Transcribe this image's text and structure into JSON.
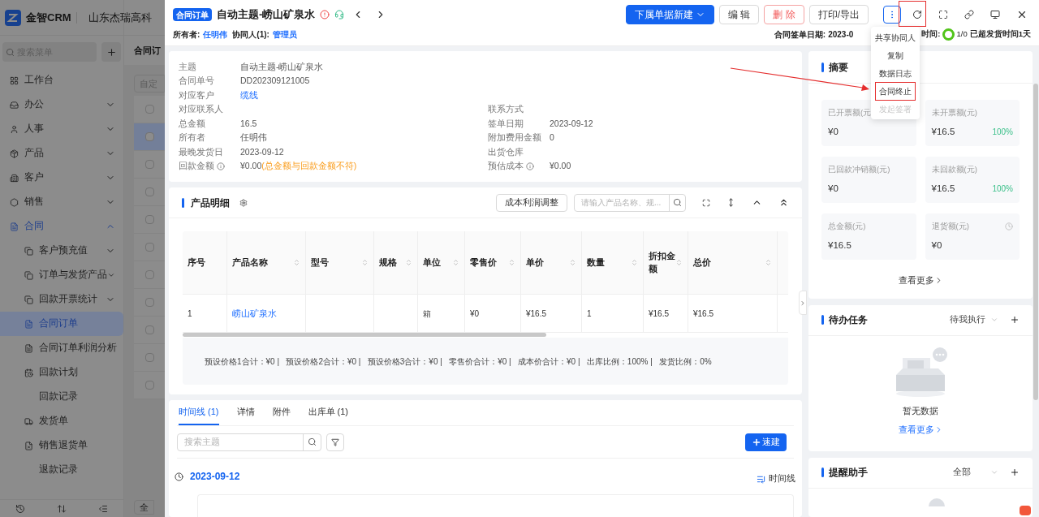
{
  "app": {
    "logo_text": "金智CRM",
    "company": "山东杰瑞高科",
    "search_placeholder": "搜索菜单",
    "menu": [
      {
        "label": "工作台",
        "selected": false
      },
      {
        "label": "办公",
        "selected": false,
        "expanded": false
      },
      {
        "label": "人事",
        "selected": false,
        "expanded": false
      },
      {
        "label": "产品",
        "selected": false,
        "expanded": false
      },
      {
        "label": "客户",
        "selected": false,
        "expanded": false
      },
      {
        "label": "销售",
        "selected": false,
        "expanded": false
      },
      {
        "label": "合同",
        "selected": false,
        "expanded": true,
        "children": [
          {
            "label": "客户预充值",
            "selected": false,
            "expanded": false
          },
          {
            "label": "订单与发货产品",
            "selected": false,
            "expanded": false
          },
          {
            "label": "回款开票统计",
            "selected": false,
            "expanded": false
          },
          {
            "label": "合同订单",
            "selected": true
          },
          {
            "label": "合同订单利润分析",
            "selected": false
          },
          {
            "label": "回款计划",
            "selected": false
          },
          {
            "label": "回款记录",
            "selected": false
          },
          {
            "label": "发货单",
            "selected": false
          },
          {
            "label": "销售退货单",
            "selected": false
          },
          {
            "label": "退款记录",
            "selected": false
          }
        ]
      }
    ],
    "list_title": "合同订",
    "list_filter": "自定",
    "list_footer": "全",
    "rows": [
      {
        "selected": false,
        "checked": false
      },
      {
        "selected": true,
        "checked": false
      },
      {
        "selected": false,
        "checked": false
      },
      {
        "selected": false,
        "checked": false
      },
      {
        "selected": false,
        "checked": false
      },
      {
        "selected": false,
        "checked": false
      },
      {
        "selected": false,
        "checked": false
      },
      {
        "selected": false,
        "checked": false
      },
      {
        "selected": false,
        "checked": false
      },
      {
        "selected": false,
        "checked": false
      },
      {
        "selected": false,
        "checked": false
      }
    ]
  },
  "drawer": {
    "badge": "合同订单",
    "title": "自动主题-崂山矿泉水",
    "buttons": [
      {
        "label": "下属单据新建",
        "kind": "primary"
      },
      {
        "label": "编 辑",
        "kind": "default"
      },
      {
        "label": "删 除",
        "kind": "danger"
      },
      {
        "label": "打印/导出",
        "kind": "default"
      }
    ],
    "meta": {
      "owner_label": "所有者:",
      "owner": "任明伟",
      "collab_label": "协同人(1):",
      "collab": "管理员",
      "sign_label": "合同签单日期:",
      "sign_date": "2023-0",
      "time_label": "时间:",
      "progress": "1/0",
      "overdue": "已超发货时间1天"
    },
    "more_menu": [
      {
        "label": "共享协同人",
        "disabled": false,
        "annotated": false
      },
      {
        "label": "复制",
        "disabled": false,
        "annotated": false
      },
      {
        "label": "数据日志",
        "disabled": false,
        "annotated": false
      },
      {
        "label": "合同终止",
        "disabled": false,
        "annotated": true
      },
      {
        "label": "发起签署",
        "disabled": true,
        "annotated": false
      }
    ],
    "info_rows": [
      {
        "left": {
          "label": "主题",
          "value": "自动主题-崂山矿泉水",
          "kind": "text"
        }
      },
      {
        "left": {
          "label": "合同单号",
          "value": "DD202309121005",
          "kind": "text"
        }
      },
      {
        "left": {
          "label": "对应客户",
          "value": "缆线",
          "kind": "link"
        }
      },
      {
        "left": {
          "label": "对应联系人"
        },
        "right": {
          "label": "联系方式"
        }
      },
      {
        "left": {
          "label": "总金额",
          "value": "16.5",
          "kind": "text"
        },
        "right": {
          "label": "签单日期",
          "value": "2023-09-12",
          "kind": "text"
        }
      },
      {
        "left": {
          "label": "所有者",
          "value": "任明伟",
          "kind": "text"
        },
        "right": {
          "label": "附加费用金额",
          "value": "0",
          "kind": "text"
        }
      },
      {
        "left": {
          "label": "最晚发货日",
          "value": "2023-09-12",
          "kind": "text"
        },
        "right": {
          "label": "出货仓库"
        }
      },
      {
        "left": {
          "label": "回款金额",
          "value": "¥0.00",
          "warning": "(总金额与回款金额不符)",
          "kind": "text",
          "info": true
        },
        "right": {
          "label": "预估成本",
          "value": "¥0.00",
          "kind": "text",
          "info": true
        }
      }
    ],
    "products": {
      "title": "产品明细",
      "adjust_button": "成本利润调整",
      "search_placeholder": "请输入产品名称、规...",
      "columns": [
        {
          "label": "序号",
          "sortable": false
        },
        {
          "label": "产品名称",
          "sortable": true
        },
        {
          "label": "型号",
          "sortable": true
        },
        {
          "label": "规格",
          "sortable": true
        },
        {
          "label": "单位",
          "sortable": true
        },
        {
          "label": "零售价",
          "sortable": true
        },
        {
          "label": "单价",
          "sortable": true
        },
        {
          "label": "数量",
          "sortable": true
        },
        {
          "label": "折扣金额",
          "sortable": true
        },
        {
          "label": "总价",
          "sortable": true
        }
      ],
      "rows": [
        [
          {
            "value": "1",
            "kind": "text"
          },
          {
            "value": "崂山矿泉水",
            "kind": "link"
          },
          null,
          null,
          {
            "value": "箱",
            "kind": "text"
          },
          {
            "value": "¥0",
            "kind": "text"
          },
          {
            "value": "¥16.5",
            "kind": "text"
          },
          {
            "value": "1",
            "kind": "text"
          },
          {
            "value": "¥16.5",
            "kind": "text"
          },
          {
            "value": "¥16.5",
            "kind": "text"
          }
        ]
      ],
      "summary": "预设价格1合计：¥0 |   预设价格2合计：¥0 |   预设价格3合计：¥0 |   零售价合计：¥0 |   成本价合计：¥0 |   出库比例：100% |   发货比例：0%"
    },
    "tabs": [
      {
        "label": "时间线 (1)",
        "selected": true
      },
      {
        "label": "详情",
        "selected": false
      },
      {
        "label": "附件",
        "selected": false
      },
      {
        "label": "出库单 (1)",
        "selected": false
      }
    ],
    "timeline": {
      "search_placeholder": "搜索主题",
      "quick_button": "速建",
      "date": "2023-09-12",
      "view_toggle": "时间线"
    },
    "summary": {
      "title": "摘要",
      "stats": [
        {
          "label": "已开票额(元",
          "value": "¥0",
          "clock": false
        },
        {
          "label": "未开票额(元)",
          "value": "¥16.5",
          "percent": "100%",
          "clock": false
        },
        {
          "label": "已回款冲销额(元)",
          "value": "¥0",
          "clock": false
        },
        {
          "label": "未回款额(元)",
          "value": "¥16.5",
          "percent": "100%",
          "clock": false
        },
        {
          "label": "总金额(元)",
          "value": "¥16.5",
          "clock": false
        },
        {
          "label": "退货额(元)",
          "value": "¥0",
          "clock": true
        }
      ],
      "more": "查看更多"
    },
    "todo": {
      "title": "待办任务",
      "filter": "待我执行",
      "empty": "暂无数据",
      "more": "查看更多"
    },
    "reminder": {
      "title": "提醒助手",
      "filter": "全部"
    }
  }
}
